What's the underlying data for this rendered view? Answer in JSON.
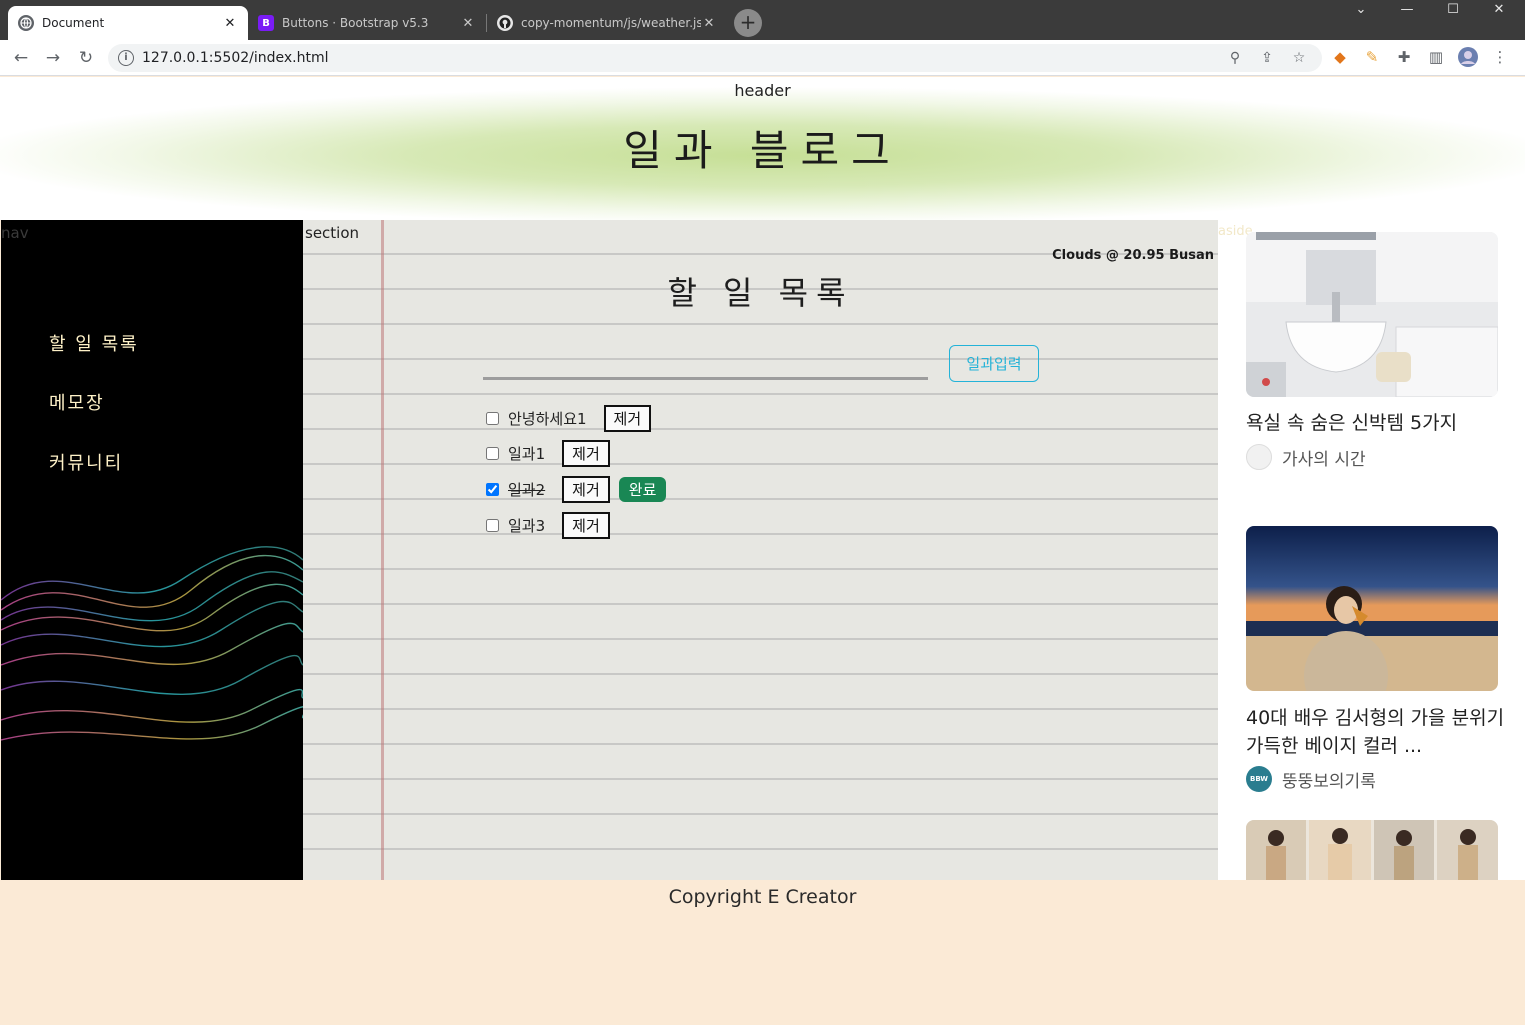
{
  "browser": {
    "tabs": [
      {
        "title": "Document",
        "favicon": "globe-icon"
      },
      {
        "title": "Buttons · Bootstrap v5.3",
        "favicon": "bootstrap-icon",
        "favicon_letter": "B"
      },
      {
        "title": "copy-momentum/js/weather.js",
        "favicon": "github-icon"
      }
    ],
    "url": "127.0.0.1:5502/index.html"
  },
  "header": {
    "tag": "header",
    "title": "일과 블로그"
  },
  "nav": {
    "tag": "nav",
    "items": [
      "할 일 목록",
      "메모장",
      "커뮤니티"
    ]
  },
  "section": {
    "tag": "section",
    "weather": "Clouds @ 20.95 Busan",
    "title": "할 일 목록",
    "input_value": "",
    "add_button": "일과입력",
    "todos": [
      {
        "text": "안녕하세요1",
        "checked": false,
        "remove": "제거"
      },
      {
        "text": "일과1",
        "checked": false,
        "remove": "제거"
      },
      {
        "text": "일과2",
        "checked": true,
        "remove": "제거",
        "complete": "완료"
      },
      {
        "text": "일과3",
        "checked": false,
        "remove": "제거"
      }
    ]
  },
  "aside": {
    "tag": "aside",
    "cards": [
      {
        "title": "욕실 속 숨은 신박템 5가지",
        "source": "가사의 시간"
      },
      {
        "title": "40대 배우 김서형의 가을 분위기 가득한 베이지 컬러 ...",
        "source": "뚱뚱보의기록",
        "source_logo_text": "BBW"
      }
    ]
  },
  "footer": {
    "text": "Copyright E Creator"
  },
  "colors": {
    "complete_green": "#198754",
    "add_button_cyan": "#24b3d8",
    "footer_bg": "#fbead6",
    "nav_text": "#fff2c8"
  }
}
